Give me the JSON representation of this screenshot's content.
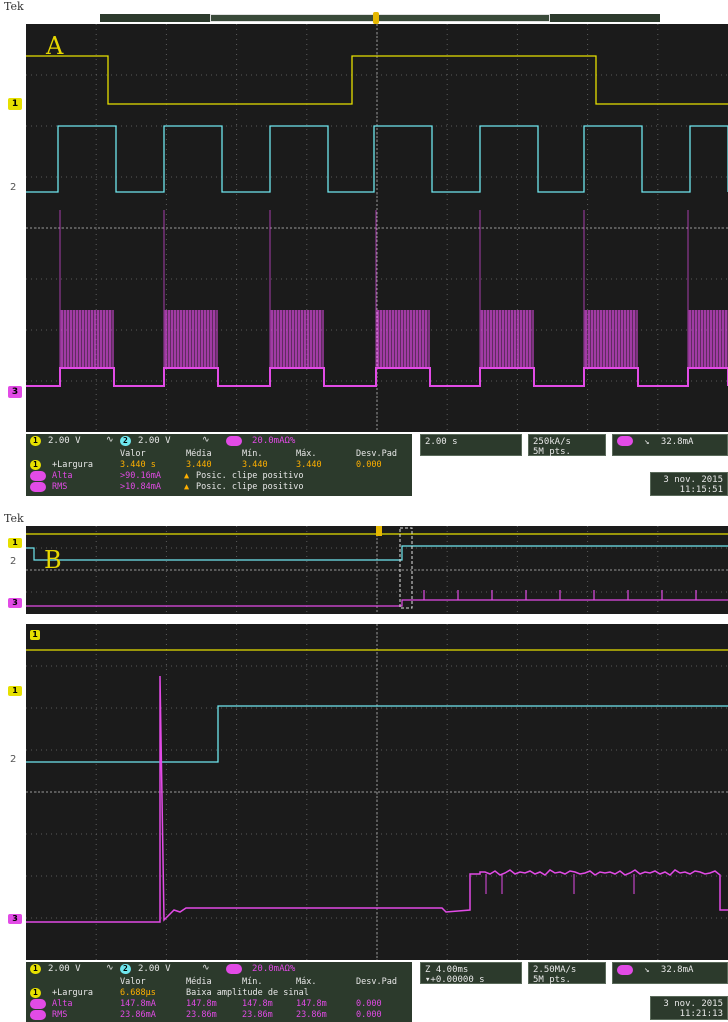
{
  "brand": "Tek",
  "panels": [
    {
      "label": "A",
      "status": {
        "ch1": "1",
        "ch1_scale": "2.00 V",
        "ch2": "2",
        "ch2_scale": "2.00 V",
        "ch3_scale": "20.0mAΩ%",
        "timebase": "2.00 s",
        "sample_rate": "250kA/s",
        "points": "5M pts.",
        "trigger_level": "32.8mA",
        "date": "3 nov. 2015",
        "time": "11:15:51"
      },
      "measurements": {
        "headers": [
          "Valor",
          "Média",
          "Mín.",
          "Máx.",
          "Desv.Pad"
        ],
        "rows": [
          {
            "ch": "1",
            "name": "+Largura",
            "values": [
              "3.440 s",
              "3.440",
              "3.440",
              "3.440",
              "0.000"
            ]
          },
          {
            "ch": "",
            "name": "Alta",
            "values": [
              ">90.16mA",
              "Posic. clipe positivo"
            ]
          },
          {
            "ch": "",
            "name": "RMS",
            "values": [
              ">10.84mA",
              "Posic. clipe positivo"
            ]
          }
        ]
      }
    },
    {
      "label": "B",
      "status": {
        "ch1": "1",
        "ch1_scale": "2.00 V",
        "ch2": "2",
        "ch2_scale": "2.00 V",
        "ch3_scale": "20.0mAΩ%",
        "zoom": "Z 4.00ms",
        "zoom_pos": "▾+0.00000 s",
        "sample_rate": "2.50MA/s",
        "points": "5M pts.",
        "trigger_level": "32.8mA",
        "date": "3 nov. 2015",
        "time": "11:21:13"
      },
      "measurements": {
        "headers": [
          "Valor",
          "Média",
          "Mín.",
          "Máx.",
          "Desv.Pad"
        ],
        "rows": [
          {
            "ch": "1",
            "name": "+Largura",
            "values": [
              "6.688µs",
              "Baixa amplitude de sinal"
            ]
          },
          {
            "ch": "",
            "name": "Alta",
            "values": [
              "147.8mA",
              "147.8m",
              "147.8m",
              "147.8m",
              "0.000"
            ]
          },
          {
            "ch": "",
            "name": "RMS",
            "values": [
              "23.86mA",
              "23.86m",
              "23.86m",
              "23.86m",
              "0.000"
            ]
          }
        ]
      }
    }
  ],
  "channel_marks": {
    "ch1": "1",
    "ch2": "2",
    "ch3": "3"
  },
  "colors": {
    "ch1": "#e6e000",
    "ch2": "#6fe7ef",
    "ch3": "#e24be6",
    "grid": "#6a6a6a",
    "screen": "#1b1b1b"
  }
}
